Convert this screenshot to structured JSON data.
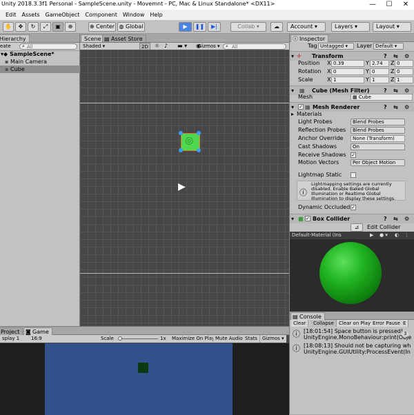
{
  "window": {
    "title": "Unity 2018.3.3f1 Personal - SampleScene.unity - Movemnt - PC, Mac & Linux Standalone* <DX11>",
    "minimize": "—",
    "maximize": "☐",
    "close": "✕"
  },
  "menu": [
    "Edit",
    "Assets",
    "GameObject",
    "Component",
    "Window",
    "Help"
  ],
  "toolbar": {
    "center": "Center",
    "global": "Global",
    "collab": "Collab",
    "account": "Account",
    "layers": "Layers",
    "layout": "Layout"
  },
  "hierarchy": {
    "tab": "Hierarchy",
    "create": "eate",
    "search_placeholder": "All",
    "scene": "SampleScene*",
    "items": [
      "Main Camera",
      "Cube"
    ]
  },
  "scene": {
    "tabs": [
      "Scene",
      "Asset Store"
    ],
    "shading": "Shaded",
    "mode_2d": "2D",
    "gizmos": "Gizmos",
    "search_placeholder": "All"
  },
  "inspector": {
    "tab": "Inspector",
    "tag_label": "Tag",
    "tag_value": "Untagged",
    "layer_label": "Layer",
    "layer_value": "Default",
    "transform": {
      "title": "Transform",
      "position_label": "Position",
      "rotation_label": "Rotation",
      "scale_label": "Scale",
      "position": {
        "x": "0.39",
        "y": "2.74",
        "z": "0"
      },
      "rotation": {
        "x": "0",
        "y": "0",
        "z": "0"
      },
      "scale": {
        "x": "1",
        "y": "1",
        "z": "1"
      }
    },
    "mesh_filter": {
      "title": "Cube (Mesh Filter)",
      "mesh_label": "Mesh",
      "mesh_value": "Cube"
    },
    "mesh_renderer": {
      "title": "Mesh Renderer",
      "materials": "Materials",
      "light_probes_label": "Light Probes",
      "light_probes_value": "Blend Probes",
      "reflection_probes_label": "Reflection Probes",
      "reflection_probes_value": "Blend Probes",
      "anchor_override_label": "Anchor Override",
      "anchor_override_value": "None (Transform)",
      "cast_shadows_label": "Cast Shadows",
      "cast_shadows_value": "On",
      "receive_shadows_label": "Receive Shadows",
      "motion_vectors_label": "Motion Vectors",
      "motion_vectors_value": "Per Object Motion",
      "lightmap_static_label": "Lightmap Static",
      "info": "Lightmapping settings are currently disabled. Enable Baked Global Illumination or Realtime Global Illumination to display these settings.",
      "dynamic_occluded_label": "Dynamic Occluded"
    },
    "box_collider": {
      "title": "Box Collider",
      "edit_collider": "Edit Collider"
    },
    "preview_title": "Default-Material (Ins"
  },
  "console": {
    "tab": "Console",
    "buttons": [
      "Clear",
      "Collapse",
      "Clear on Play",
      "Error Pause",
      "E"
    ],
    "count": "3",
    "rows": [
      {
        "line1": "[18:01:54] Space button is pressed!",
        "line2": "UnityEngine.MonoBehaviour:print(Obje"
      },
      {
        "line1": "[18:08:13] Should not be capturing wh",
        "line2": "UnityEngine.GUIUtility:ProcessEvent(In"
      }
    ]
  },
  "game": {
    "tabs": [
      "Project",
      "Game"
    ],
    "display": "splay 1",
    "aspect": "16:9",
    "scale_label": "Scale",
    "scale_value": "1x",
    "maximize_on_play": "Maximize On Play",
    "mute_audio": "Mute Audio",
    "stats": "Stats",
    "gizmos": "Gizmos"
  }
}
